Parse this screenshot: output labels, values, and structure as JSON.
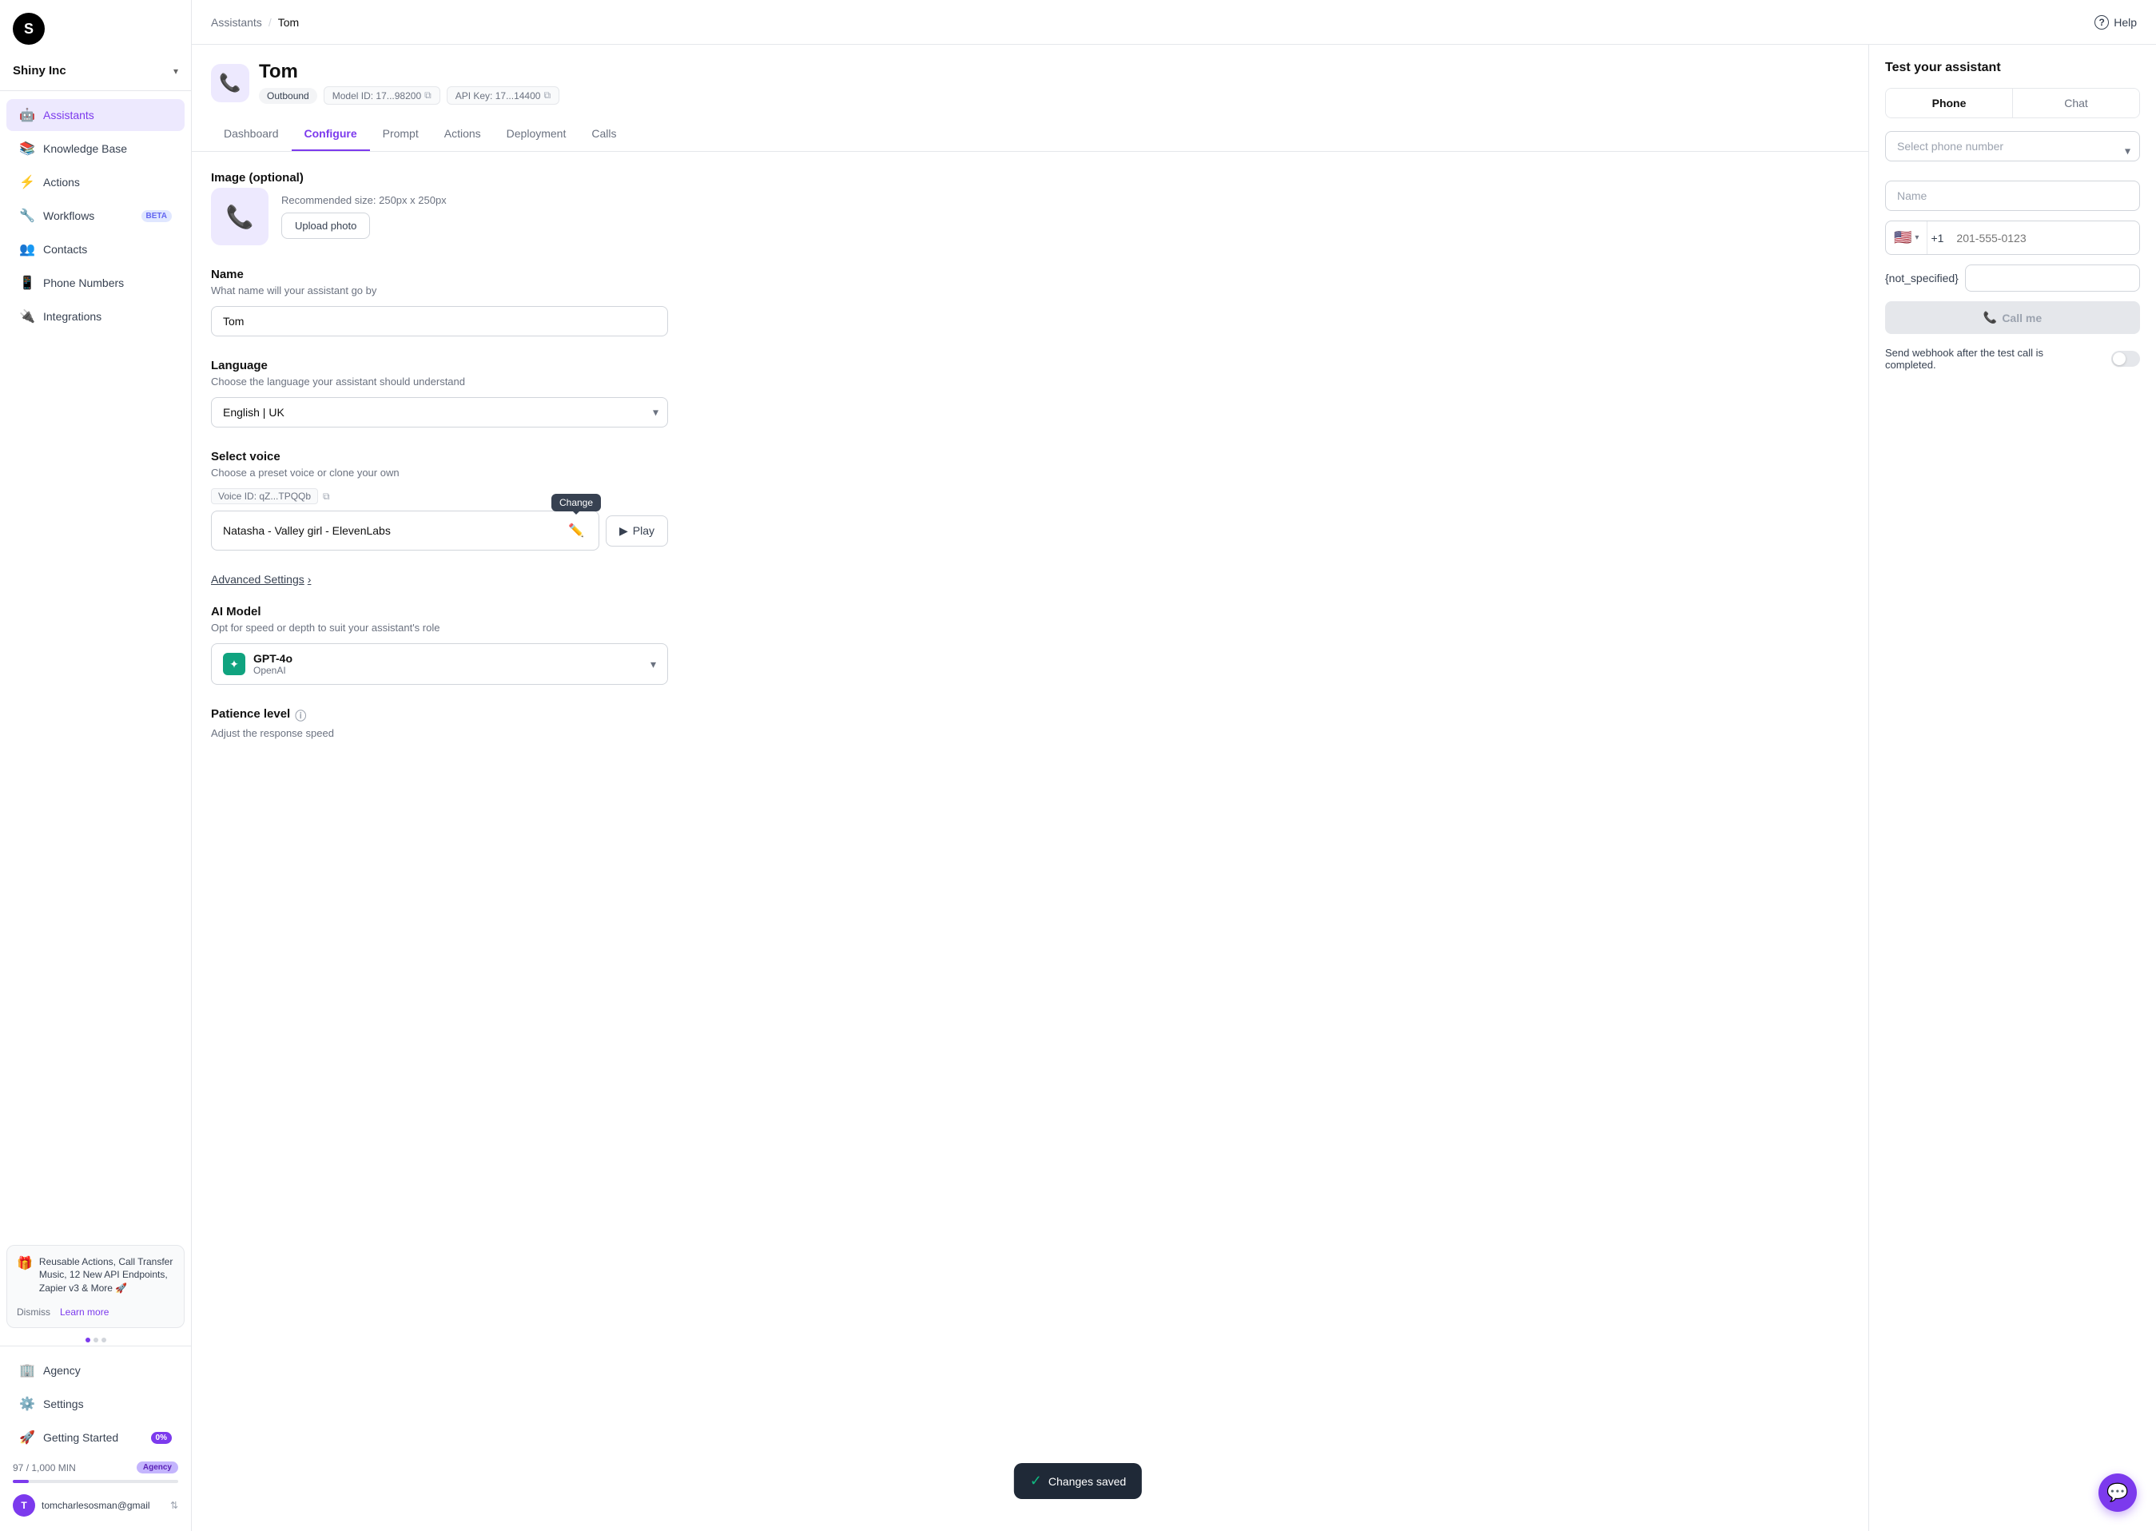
{
  "app": {
    "logo_letter": "S",
    "org_name": "Shiny Inc"
  },
  "sidebar": {
    "items": [
      {
        "id": "assistants",
        "label": "Assistants",
        "icon": "🤖",
        "active": true
      },
      {
        "id": "knowledge-base",
        "label": "Knowledge Base",
        "icon": "📚",
        "active": false
      },
      {
        "id": "actions",
        "label": "Actions",
        "icon": "⚡",
        "active": false
      },
      {
        "id": "workflows",
        "label": "Workflows",
        "icon": "🔧",
        "active": false,
        "badge": "BETA"
      },
      {
        "id": "contacts",
        "label": "Contacts",
        "icon": "👥",
        "active": false
      },
      {
        "id": "phone-numbers",
        "label": "Phone Numbers",
        "icon": "📱",
        "active": false
      },
      {
        "id": "integrations",
        "label": "Integrations",
        "icon": "🔌",
        "active": false
      }
    ],
    "bottom_items": [
      {
        "id": "agency",
        "label": "Agency",
        "icon": "🏢"
      },
      {
        "id": "settings",
        "label": "Settings",
        "icon": "⚙️"
      },
      {
        "id": "getting-started",
        "label": "Getting Started",
        "icon": "🚀",
        "badge": "0%"
      }
    ],
    "promo": {
      "text": "Reusable Actions, Call Transfer Music, 12 New API Endpoints, Zapier v3 & More 🚀",
      "dismiss_label": "Dismiss",
      "learn_label": "Learn more"
    },
    "usage": {
      "current": "97",
      "max": "1,000",
      "unit": "MIN",
      "percent": 9.7,
      "badge": "Agency"
    },
    "user_email": "tomcharlesosman@gmail"
  },
  "topbar": {
    "breadcrumb_root": "Assistants",
    "breadcrumb_current": "Tom",
    "help_label": "Help"
  },
  "assistant": {
    "name": "Tom",
    "type_badge": "Outbound",
    "model_id": "Model ID: 17...98200",
    "api_key": "API Key: 17...14400",
    "tabs": [
      {
        "id": "dashboard",
        "label": "Dashboard",
        "active": false
      },
      {
        "id": "configure",
        "label": "Configure",
        "active": true
      },
      {
        "id": "prompt",
        "label": "Prompt",
        "active": false
      },
      {
        "id": "actions",
        "label": "Actions",
        "active": false
      },
      {
        "id": "deployment",
        "label": "Deployment",
        "active": false
      },
      {
        "id": "calls",
        "label": "Calls",
        "active": false
      }
    ]
  },
  "form": {
    "image_section": {
      "title": "Image (optional)",
      "hint": "Recommended size: 250px x 250px",
      "upload_btn": "Upload photo"
    },
    "name_section": {
      "title": "Name",
      "desc": "What name will your assistant go by",
      "value": "Tom"
    },
    "language_section": {
      "title": "Language",
      "desc": "Choose the language your assistant should understand",
      "value": "English | UK"
    },
    "voice_section": {
      "title": "Select voice",
      "desc": "Choose a preset voice or clone your own",
      "voice_id_label": "Voice ID: qZ...TPQQb",
      "voice_name": "Natasha - Valley girl - ElevenLabs",
      "change_tooltip": "Change",
      "play_btn": "Play"
    },
    "advanced_settings": {
      "label": "Advanced Settings"
    },
    "ai_model_section": {
      "title": "AI Model",
      "desc": "Opt for speed or depth to suit your assistant's role",
      "model_name": "GPT-4o",
      "model_sub": "OpenAI"
    },
    "patience_section": {
      "title": "Patience level",
      "desc": "Adjust the response speed"
    }
  },
  "right_panel": {
    "title": "Test your assistant",
    "phone_tab": "Phone",
    "chat_tab": "Chat",
    "phone_select_placeholder": "Select phone number",
    "name_placeholder": "Name",
    "phone_flag": "🇺🇸",
    "phone_code": "+1",
    "phone_placeholder": "201-555-0123",
    "not_specified_label": "{not_specified}",
    "call_me_btn": "Call me",
    "phone_icon": "📞",
    "webhook_text": "Send webhook after the test call is completed."
  },
  "toast": {
    "icon": "✓",
    "message": "Changes saved"
  }
}
